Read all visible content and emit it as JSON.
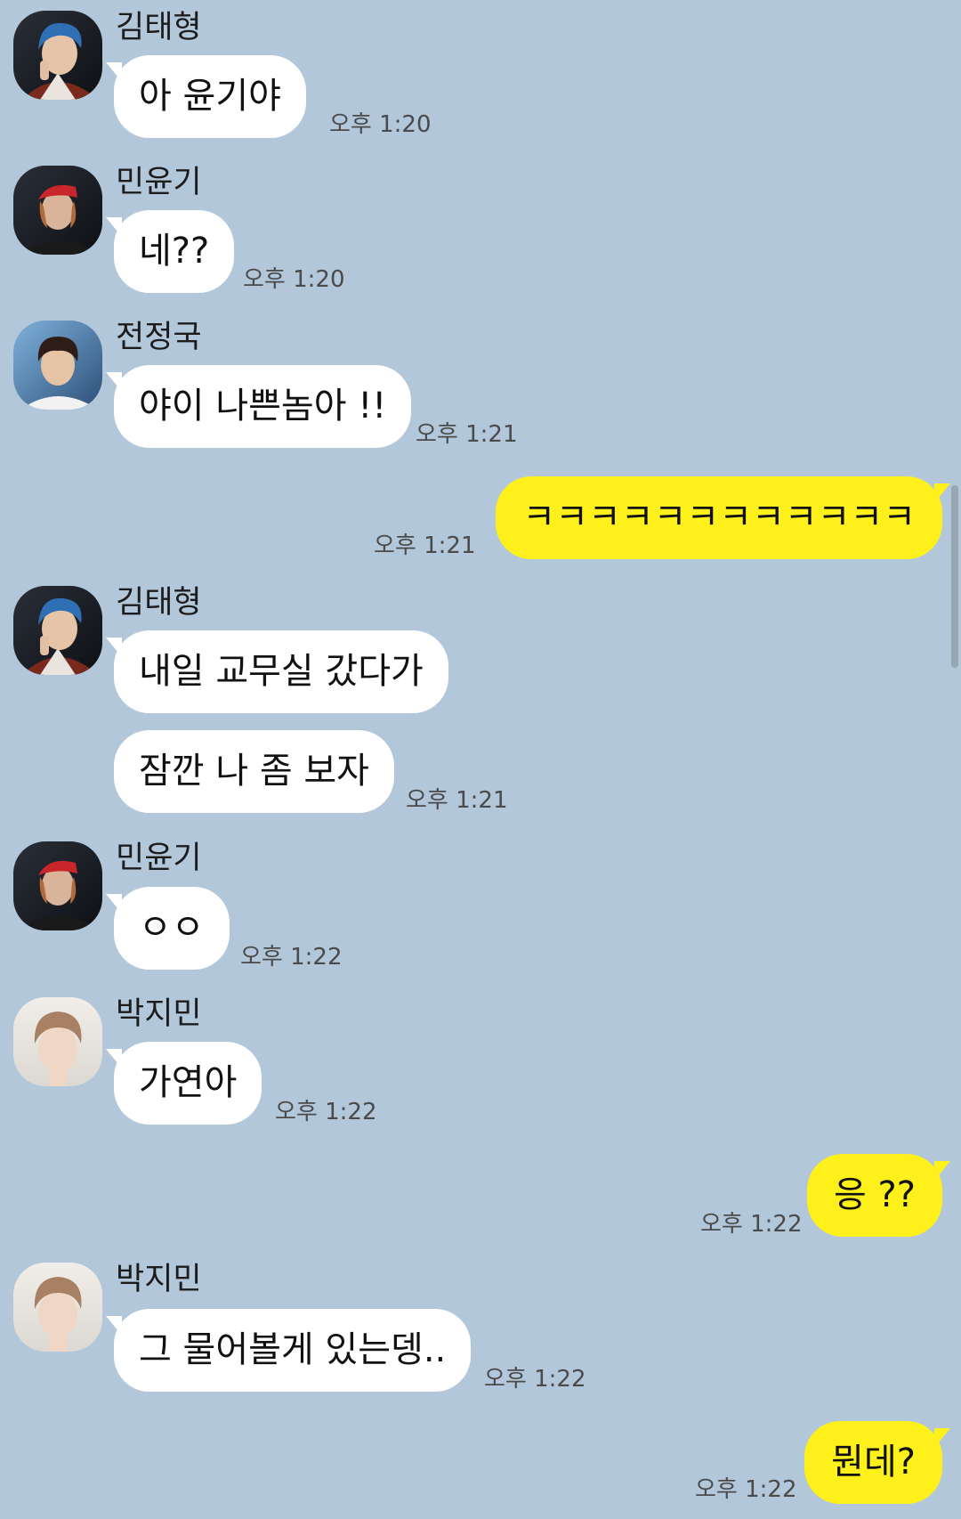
{
  "messages": [
    {
      "sender": "김태형",
      "text": "아 윤기야",
      "time": "오후 1:20"
    },
    {
      "sender": "민윤기",
      "text": "네??",
      "time": "오후 1:20"
    },
    {
      "sender": "전정국",
      "text": "야이 나쁜놈아 !!",
      "time": "오후 1:21"
    },
    {
      "text": "ㅋㅋㅋㅋㅋㅋㅋㅋㅋㅋㅋㅋ",
      "time": "오후 1:21"
    },
    {
      "sender": "김태형",
      "text": "내일 교무실 갔다가"
    },
    {
      "text": "잠깐 나 좀 보자",
      "time": "오후 1:21"
    },
    {
      "sender": "민윤기",
      "text": "ㅇㅇ",
      "time": "오후 1:22"
    },
    {
      "sender": "박지민",
      "text": "가연아",
      "time": "오후 1:22"
    },
    {
      "text": "응 ??",
      "time": "오후 1:22"
    },
    {
      "sender": "박지민",
      "text": "그 물어볼게 있는뎅..",
      "time": "오후 1:22"
    },
    {
      "text": "뭔데?",
      "time": "오후 1:22"
    }
  ]
}
